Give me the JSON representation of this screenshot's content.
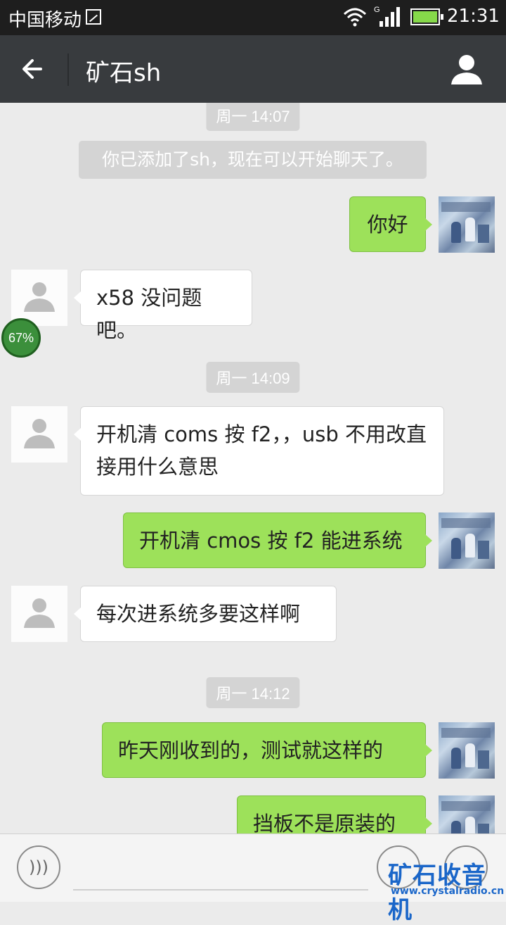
{
  "status_bar": {
    "carrier": "中国移动",
    "network": "G",
    "time": "21:31"
  },
  "header": {
    "back_icon": "arrow-left-icon",
    "title": "矿石sh",
    "profile_icon": "person-icon"
  },
  "chat": {
    "timestamps": [
      "周一 14:07",
      "周一 14:09",
      "周一 14:12"
    ],
    "system_message": "你已添加了sh，现在可以开始聊天了。",
    "messages": [
      {
        "sender": "me",
        "text": "你好"
      },
      {
        "sender": "other",
        "text": "x58 没问题吧。"
      },
      {
        "sender": "other",
        "text": "开机清 coms 按 f2，，usb 不用改直接用什么意思"
      },
      {
        "sender": "me",
        "text": "开机清 cmos 按 f2 能进系统"
      },
      {
        "sender": "other",
        "text": "每次进系统多要这样啊"
      },
      {
        "sender": "me",
        "text": "昨天刚收到的，测试就这样的"
      },
      {
        "sender": "me",
        "text": "挡板不是原装的"
      }
    ],
    "overlay_progress": "67%"
  },
  "input_bar": {
    "voice_icon": "voice-icon",
    "emoji_icon": "emoji-icon",
    "plus_icon": "plus-icon"
  },
  "watermark": {
    "title": "矿石收音机",
    "url": "www.crystalradio.cn"
  },
  "colors": {
    "header": "#383b3e",
    "my_bubble": "#9de15a",
    "background": "#ebebeb"
  }
}
